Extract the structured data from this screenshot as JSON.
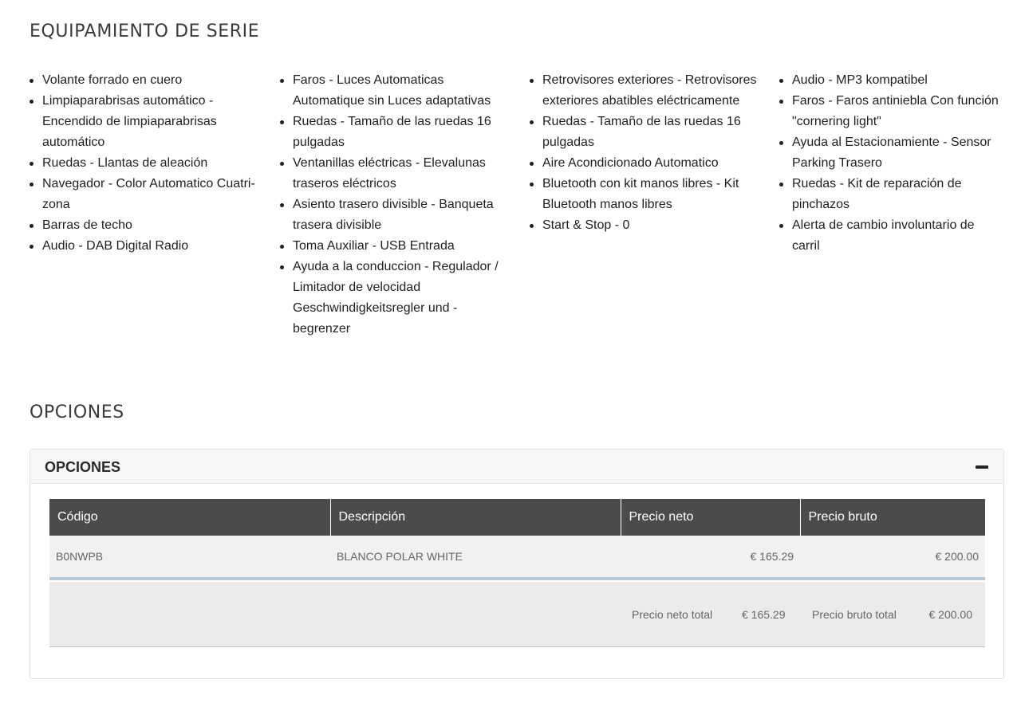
{
  "equipamiento": {
    "heading": "EQUIPAMIENTO DE SERIE",
    "columns": [
      [
        "Volante forrado en cuero",
        "Limpiaparabrisas automático - Encendido de limpiaparabrisas automático",
        "Ruedas - Llantas de aleación",
        "Navegador - Color Automatico Cuatri-zona",
        "Barras de techo",
        "Audio - DAB Digital Radio"
      ],
      [
        "Faros - Luces Automaticas Automatique sin Luces adaptativas",
        "Ruedas - Tamaño de las ruedas 16 pulgadas",
        "Ventanillas eléctricas - Elevalunas traseros eléctricos",
        "Asiento trasero divisible - Banqueta trasera divisible",
        "Toma Auxiliar - USB Entrada",
        "Ayuda a la conduccion - Regulador / Limitador de velocidad Geschwindigkeitsregler und -begrenzer"
      ],
      [
        "Retrovisores exteriores - Retrovisores exteriores abatibles eléctricamente",
        "Ruedas - Tamaño de las ruedas 16 pulgadas",
        "Aire Acondicionado Automatico",
        "Bluetooth con kit manos libres - Kit Bluetooth manos libres",
        "Start & Stop - 0"
      ],
      [
        "Audio - MP3 kompatibel",
        "Faros - Faros antiniebla Con función \"cornering light\"",
        "Ayuda al Estacionamiente - Sensor Parking Trasero",
        "Ruedas - Kit de reparación de pinchazos",
        "Alerta de cambio involuntario de carril"
      ]
    ]
  },
  "opciones": {
    "heading": "OPCIONES",
    "panel_title": "OPCIONES",
    "collapse_icon": "minus-icon",
    "table": {
      "headers": [
        "Código",
        "Descripción",
        "Precio neto",
        "Precio bruto"
      ],
      "rows": [
        [
          "B0NWPB",
          "BLANCO POLAR WHITE",
          "€ 165.29",
          "€ 200.00"
        ]
      ]
    },
    "totals": {
      "neto_label": "Precio neto total",
      "neto_value": "€ 165.29",
      "bruto_label": "Precio bruto total",
      "bruto_value": "€ 200.00"
    }
  }
}
